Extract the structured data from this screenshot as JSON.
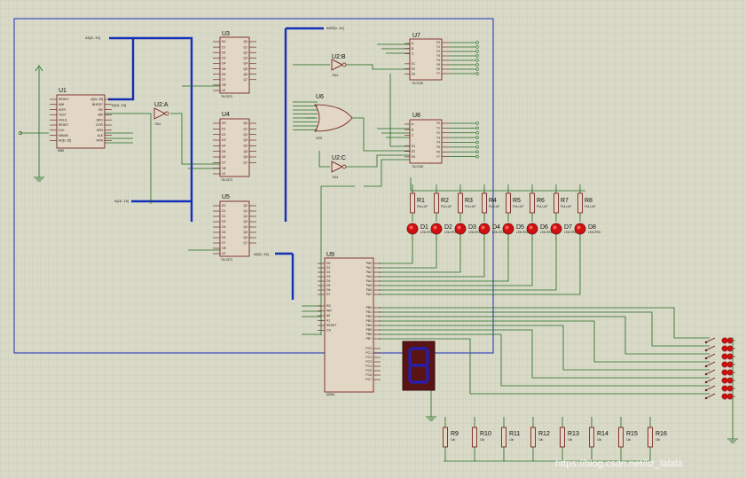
{
  "colors": {
    "grid": "#c4c4b2",
    "background": "#d9d9c8",
    "bus": "#1430b8",
    "wire": "#1f6b1f",
    "chip_fill": "#e2d7c4",
    "chip_border": "#6b1010",
    "led": "#d01010",
    "seg": "#2020c0"
  },
  "chips": {
    "u1": {
      "ref": "U1",
      "part": "8086",
      "pins": [
        "READY",
        "NMI",
        "INTR",
        "TEST",
        "HOLD",
        "RESET",
        "CLK",
        "MN/MX",
        "AD[0..15]",
        "A[16..19]",
        "BHE/S7",
        "RD",
        "WR",
        "M/IO",
        "DT/R",
        "DEN",
        "ALE",
        "INTA"
      ]
    },
    "u2a": {
      "ref": "U2:A",
      "part": "7404"
    },
    "u2b": {
      "ref": "U2:B",
      "part": "7404"
    },
    "u2c": {
      "ref": "U2:C",
      "part": "7404"
    },
    "u3": {
      "ref": "U3",
      "part": "74LS373",
      "pins": [
        "D0",
        "D1",
        "D2",
        "D3",
        "D4",
        "D5",
        "D6",
        "D7",
        "OE",
        "LE",
        "Q0",
        "Q1",
        "Q2",
        "Q3",
        "Q4",
        "Q5",
        "Q6",
        "Q7"
      ]
    },
    "u4": {
      "ref": "U4",
      "part": "74LS373",
      "pins": [
        "D0",
        "D1",
        "D2",
        "D3",
        "D4",
        "D5",
        "D6",
        "D7",
        "OE",
        "LE",
        "Q0",
        "Q1",
        "Q2",
        "Q3",
        "Q4",
        "Q5",
        "Q6",
        "Q7"
      ]
    },
    "u5": {
      "ref": "U5",
      "part": "74LS373",
      "pins": [
        "D0",
        "D1",
        "D2",
        "D3",
        "D4",
        "D5",
        "D6",
        "D7",
        "OE",
        "LE",
        "Q0",
        "Q1",
        "Q2",
        "Q3",
        "Q4",
        "Q5",
        "Q6",
        "Q7"
      ]
    },
    "u6": {
      "ref": "U6",
      "part": "4078"
    },
    "u7": {
      "ref": "U7",
      "part": "74LS138",
      "pins": [
        "A",
        "B",
        "C",
        "E1",
        "E2",
        "E3",
        "Y0",
        "Y1",
        "Y2",
        "Y3",
        "Y4",
        "Y5",
        "Y6",
        "Y7"
      ]
    },
    "u8": {
      "ref": "U8",
      "part": "74LS138",
      "pins": [
        "A",
        "B",
        "C",
        "E1",
        "E2",
        "E3",
        "Y0",
        "Y1",
        "Y2",
        "Y3",
        "Y4",
        "Y5",
        "Y6",
        "Y7"
      ]
    },
    "u9": {
      "ref": "U9",
      "part": "8255A",
      "pins_left": [
        "D0",
        "D1",
        "D2",
        "D3",
        "D4",
        "D5",
        "D6",
        "D7",
        "RD",
        "WR",
        "A0",
        "A1",
        "RESET",
        "CS"
      ],
      "pins_right": [
        "PA0",
        "PA1",
        "PA2",
        "PA3",
        "PA4",
        "PA5",
        "PA6",
        "PA7",
        "PB0",
        "PB1",
        "PB2",
        "PB3",
        "PB4",
        "PB5",
        "PB6",
        "PB7",
        "PC0",
        "PC1",
        "PC2",
        "PC3",
        "PC4",
        "PC5",
        "PC6",
        "PC7"
      ]
    }
  },
  "nets": {
    "ad_bus": "AD[0..15]",
    "a_bus": "A[16..19]",
    "addr_bus": "ADR[0..19]",
    "ad_bus_u9": "AD[0..15]"
  },
  "resistors_top": [
    {
      "ref": "R1",
      "val": "PULLUP"
    },
    {
      "ref": "R2",
      "val": "PULLUP"
    },
    {
      "ref": "R3",
      "val": "PULLUP"
    },
    {
      "ref": "R4",
      "val": "PULLUP"
    },
    {
      "ref": "R5",
      "val": "PULLUP"
    },
    {
      "ref": "R6",
      "val": "PULLUP"
    },
    {
      "ref": "R7",
      "val": "PULLUP"
    },
    {
      "ref": "R8",
      "val": "PULLUP"
    }
  ],
  "leds": [
    {
      "ref": "D1",
      "val": "LED-RED"
    },
    {
      "ref": "D2",
      "val": "LED-RED"
    },
    {
      "ref": "D3",
      "val": "LED-RED"
    },
    {
      "ref": "D4",
      "val": "LED-RED"
    },
    {
      "ref": "D5",
      "val": "LED-RED"
    },
    {
      "ref": "D6",
      "val": "LED-RED"
    },
    {
      "ref": "D7",
      "val": "LED-RED"
    },
    {
      "ref": "D8",
      "val": "LED-RED"
    }
  ],
  "resistors_bottom": [
    {
      "ref": "R9",
      "val": "10k"
    },
    {
      "ref": "R10",
      "val": "10k"
    },
    {
      "ref": "R11",
      "val": "10k"
    },
    {
      "ref": "R12",
      "val": "10k"
    },
    {
      "ref": "R13",
      "val": "10k"
    },
    {
      "ref": "R14",
      "val": "10k"
    },
    {
      "ref": "R15",
      "val": "10k"
    },
    {
      "ref": "R16",
      "val": "10k"
    }
  ],
  "watermark": "https://blog.csdn.net/liz_lalala"
}
